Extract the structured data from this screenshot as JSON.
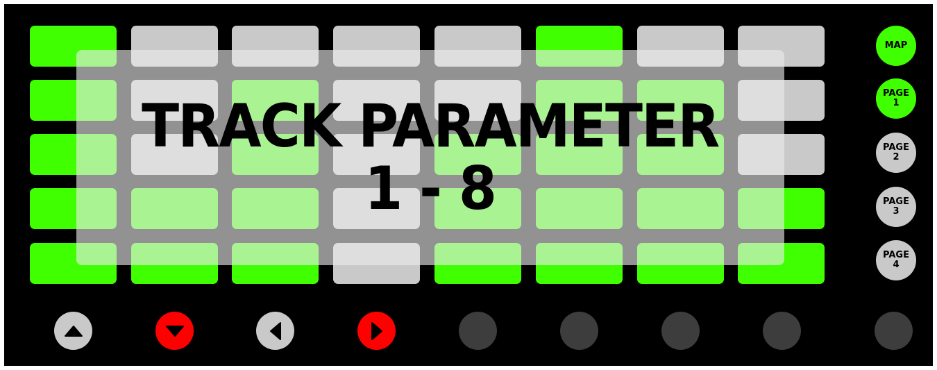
{
  "colors": {
    "green": "#3fff00",
    "gray": "#c9c9c9",
    "red": "#ff0000",
    "dark": "#3d3d3d",
    "background": "#000000"
  },
  "grid": {
    "rows": [
      [
        "green",
        "gray",
        "gray",
        "gray",
        "gray",
        "green",
        "gray",
        "gray"
      ],
      [
        "green",
        "gray",
        "green",
        "gray",
        "gray",
        "green",
        "green",
        "gray"
      ],
      [
        "green",
        "gray",
        "green",
        "gray",
        "green",
        "green",
        "green",
        "gray"
      ],
      [
        "green",
        "green",
        "green",
        "gray",
        "green",
        "green",
        "green",
        "green"
      ],
      [
        "green",
        "green",
        "green",
        "gray",
        "green",
        "green",
        "green",
        "green"
      ]
    ]
  },
  "side_buttons": [
    {
      "line1": "MAP",
      "line2": "",
      "color": "green"
    },
    {
      "line1": "PAGE",
      "line2": "1",
      "color": "green"
    },
    {
      "line1": "PAGE",
      "line2": "2",
      "color": "gray"
    },
    {
      "line1": "PAGE",
      "line2": "3",
      "color": "gray"
    },
    {
      "line1": "PAGE",
      "line2": "4",
      "color": "gray"
    }
  ],
  "nav_buttons": [
    {
      "icon": "arrow-up-icon",
      "color": "gray"
    },
    {
      "icon": "arrow-down-icon",
      "color": "red"
    },
    {
      "icon": "arrow-left-icon",
      "color": "gray"
    },
    {
      "icon": "arrow-right-icon",
      "color": "red"
    },
    {
      "icon": "none",
      "color": "dark"
    },
    {
      "icon": "none",
      "color": "dark"
    },
    {
      "icon": "none",
      "color": "dark"
    },
    {
      "icon": "none",
      "color": "dark"
    },
    {
      "icon": "none",
      "color": "dark"
    }
  ],
  "overlay": {
    "title_line1": "TRACK PARAMETER",
    "title_line2": "1 - 8"
  }
}
